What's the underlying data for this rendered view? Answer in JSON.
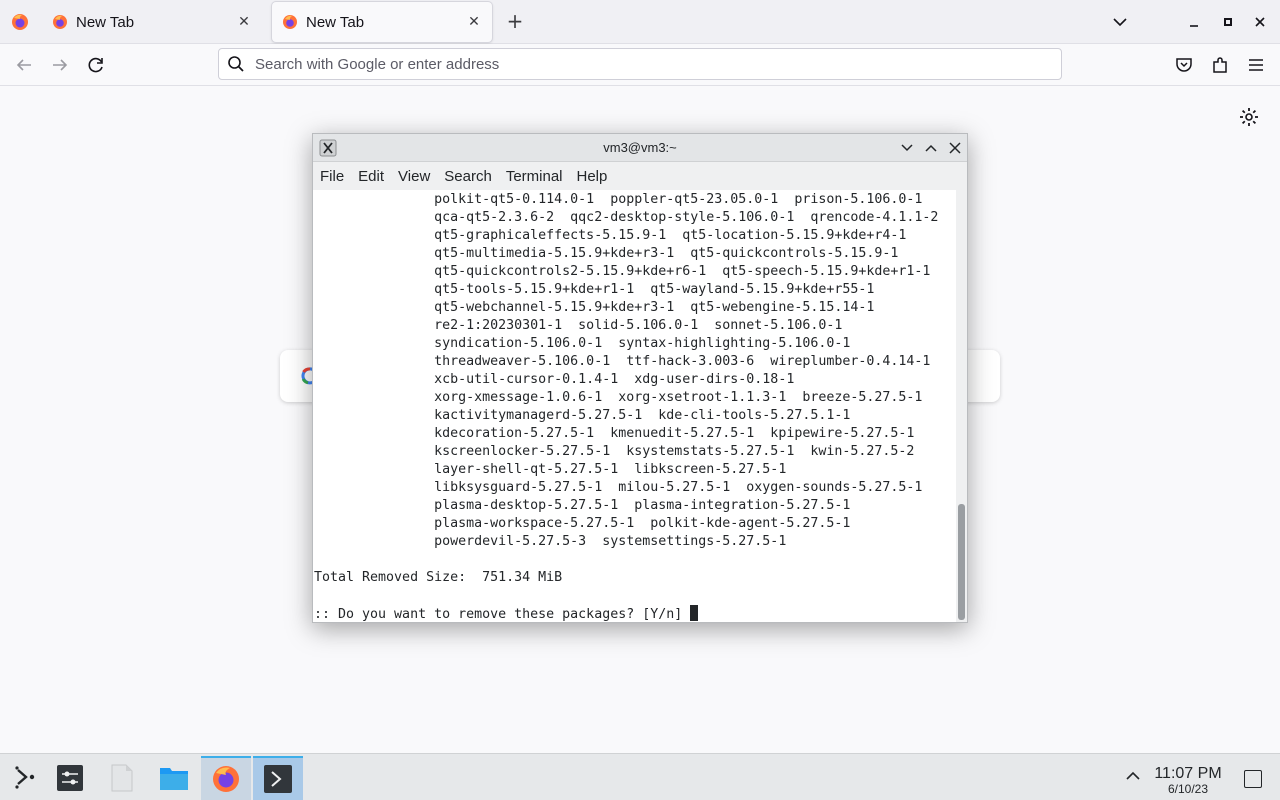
{
  "browser": {
    "tabs": [
      {
        "label": "New Tab",
        "active": false
      },
      {
        "label": "New Tab",
        "active": true
      }
    ],
    "urlbar": {
      "placeholder": "Search with Google or enter address"
    }
  },
  "terminal": {
    "title": "vm3@vm3:~",
    "menu": [
      "File",
      "Edit",
      "View",
      "Search",
      "Terminal",
      "Help"
    ],
    "lines": [
      "               polkit-qt5-0.114.0-1  poppler-qt5-23.05.0-1  prison-5.106.0-1",
      "               qca-qt5-2.3.6-2  qqc2-desktop-style-5.106.0-1  qrencode-4.1.1-2",
      "               qt5-graphicaleffects-5.15.9-1  qt5-location-5.15.9+kde+r4-1",
      "               qt5-multimedia-5.15.9+kde+r3-1  qt5-quickcontrols-5.15.9-1",
      "               qt5-quickcontrols2-5.15.9+kde+r6-1  qt5-speech-5.15.9+kde+r1-1",
      "               qt5-tools-5.15.9+kde+r1-1  qt5-wayland-5.15.9+kde+r55-1",
      "               qt5-webchannel-5.15.9+kde+r3-1  qt5-webengine-5.15.14-1",
      "               re2-1:20230301-1  solid-5.106.0-1  sonnet-5.106.0-1",
      "               syndication-5.106.0-1  syntax-highlighting-5.106.0-1",
      "               threadweaver-5.106.0-1  ttf-hack-3.003-6  wireplumber-0.4.14-1",
      "               xcb-util-cursor-0.1.4-1  xdg-user-dirs-0.18-1",
      "               xorg-xmessage-1.0.6-1  xorg-xsetroot-1.1.3-1  breeze-5.27.5-1",
      "               kactivitymanagerd-5.27.5-1  kde-cli-tools-5.27.5.1-1",
      "               kdecoration-5.27.5-1  kmenuedit-5.27.5-1  kpipewire-5.27.5-1",
      "               kscreenlocker-5.27.5-1  ksystemstats-5.27.5-1  kwin-5.27.5-2",
      "               layer-shell-qt-5.27.5-1  libkscreen-5.27.5-1",
      "               libksysguard-5.27.5-1  milou-5.27.5-1  oxygen-sounds-5.27.5-1",
      "               plasma-desktop-5.27.5-1  plasma-integration-5.27.5-1",
      "               plasma-workspace-5.27.5-1  polkit-kde-agent-5.27.5-1",
      "               powerdevil-5.27.5-3  systemsettings-5.27.5-1",
      "",
      "Total Removed Size:  751.34 MiB",
      "",
      ":: Do you want to remove these packages? [Y/n] "
    ]
  },
  "taskbar": {
    "clock_time": "11:07 PM",
    "clock_date": "6/10/23"
  }
}
